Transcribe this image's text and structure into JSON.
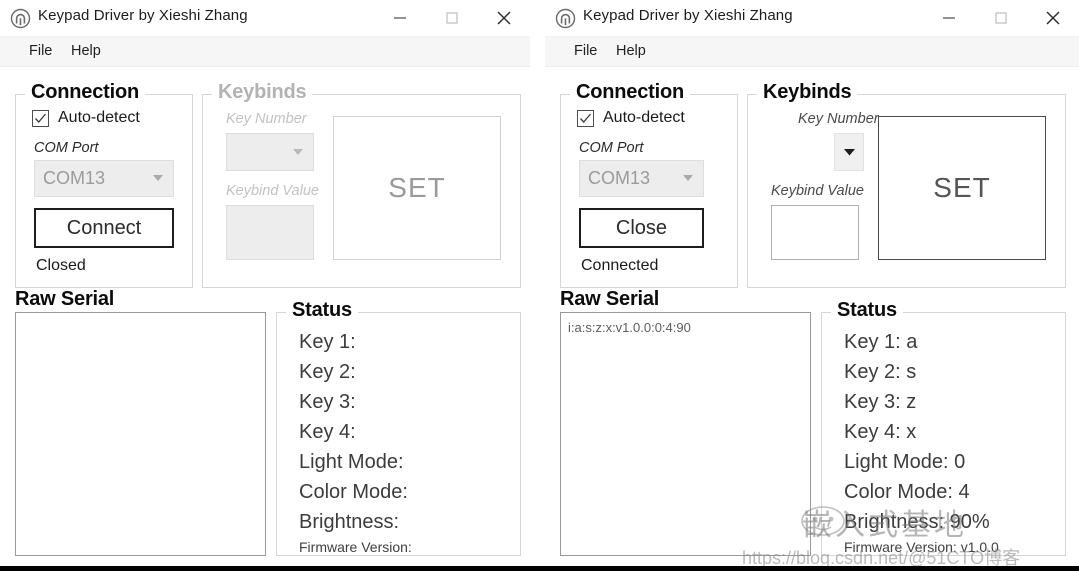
{
  "window_title": "Keypad Driver by Xieshi Zhang",
  "app_icon": "open-source-logo-icon",
  "window_controls": {
    "minimize": "minimize-icon",
    "maximize": "maximize-icon",
    "close": "close-icon"
  },
  "menu": {
    "file": "File",
    "help": "Help"
  },
  "left_window": {
    "connection": {
      "title": "Connection",
      "auto_detect_label": "Auto-detect",
      "auto_detect_checked": true,
      "com_port_label": "COM Port",
      "com_port_value": "COM13",
      "com_port_enabled": false,
      "action_button": "Connect",
      "state_text": "Closed"
    },
    "keybinds": {
      "title": "Keybinds",
      "enabled": false,
      "key_number_label": "Key Number",
      "key_number_value": "",
      "keybind_value_label": "Keybind Value",
      "keybind_value": "",
      "set_button": "SET"
    },
    "raw_serial": {
      "title": "Raw Serial",
      "content": ""
    },
    "status": {
      "title": "Status",
      "lines": [
        "Key 1:",
        "Key 2:",
        "Key 3:",
        "Key 4:",
        "Light Mode:",
        "Color Mode:",
        "Brightness:"
      ],
      "firmware": "Firmware Version:"
    }
  },
  "right_window": {
    "connection": {
      "title": "Connection",
      "auto_detect_label": "Auto-detect",
      "auto_detect_checked": true,
      "com_port_label": "COM Port",
      "com_port_value": "COM13",
      "com_port_enabled": false,
      "action_button": "Close",
      "state_text": "Connected"
    },
    "keybinds": {
      "title": "Keybinds",
      "enabled": true,
      "key_number_label": "Key Number",
      "key_number_value": "",
      "keybind_value_label": "Keybind Value",
      "keybind_value": "",
      "set_button": "SET"
    },
    "raw_serial": {
      "title": "Raw Serial",
      "content": "i:a:s:z:x:v1.0.0:0:4:90"
    },
    "status": {
      "title": "Status",
      "lines": [
        "Key 1: a",
        "Key 2: s",
        "Key 3: z",
        "Key 4: x",
        "Light Mode: 0",
        "Color Mode: 4",
        "Brightness: 90%"
      ],
      "firmware": "Firmware Version: v1.0.0"
    }
  },
  "watermark": {
    "brand": "嵌入式基地",
    "url": "https://blog.csdn.net/@51CTO博客"
  },
  "colors": {
    "window_bg": "#ffffff",
    "menubar_bg": "#f6f6f6",
    "group_border": "#d6d6d6",
    "disabled_text": "#b3b3b3",
    "text": "#1a1a1a"
  }
}
